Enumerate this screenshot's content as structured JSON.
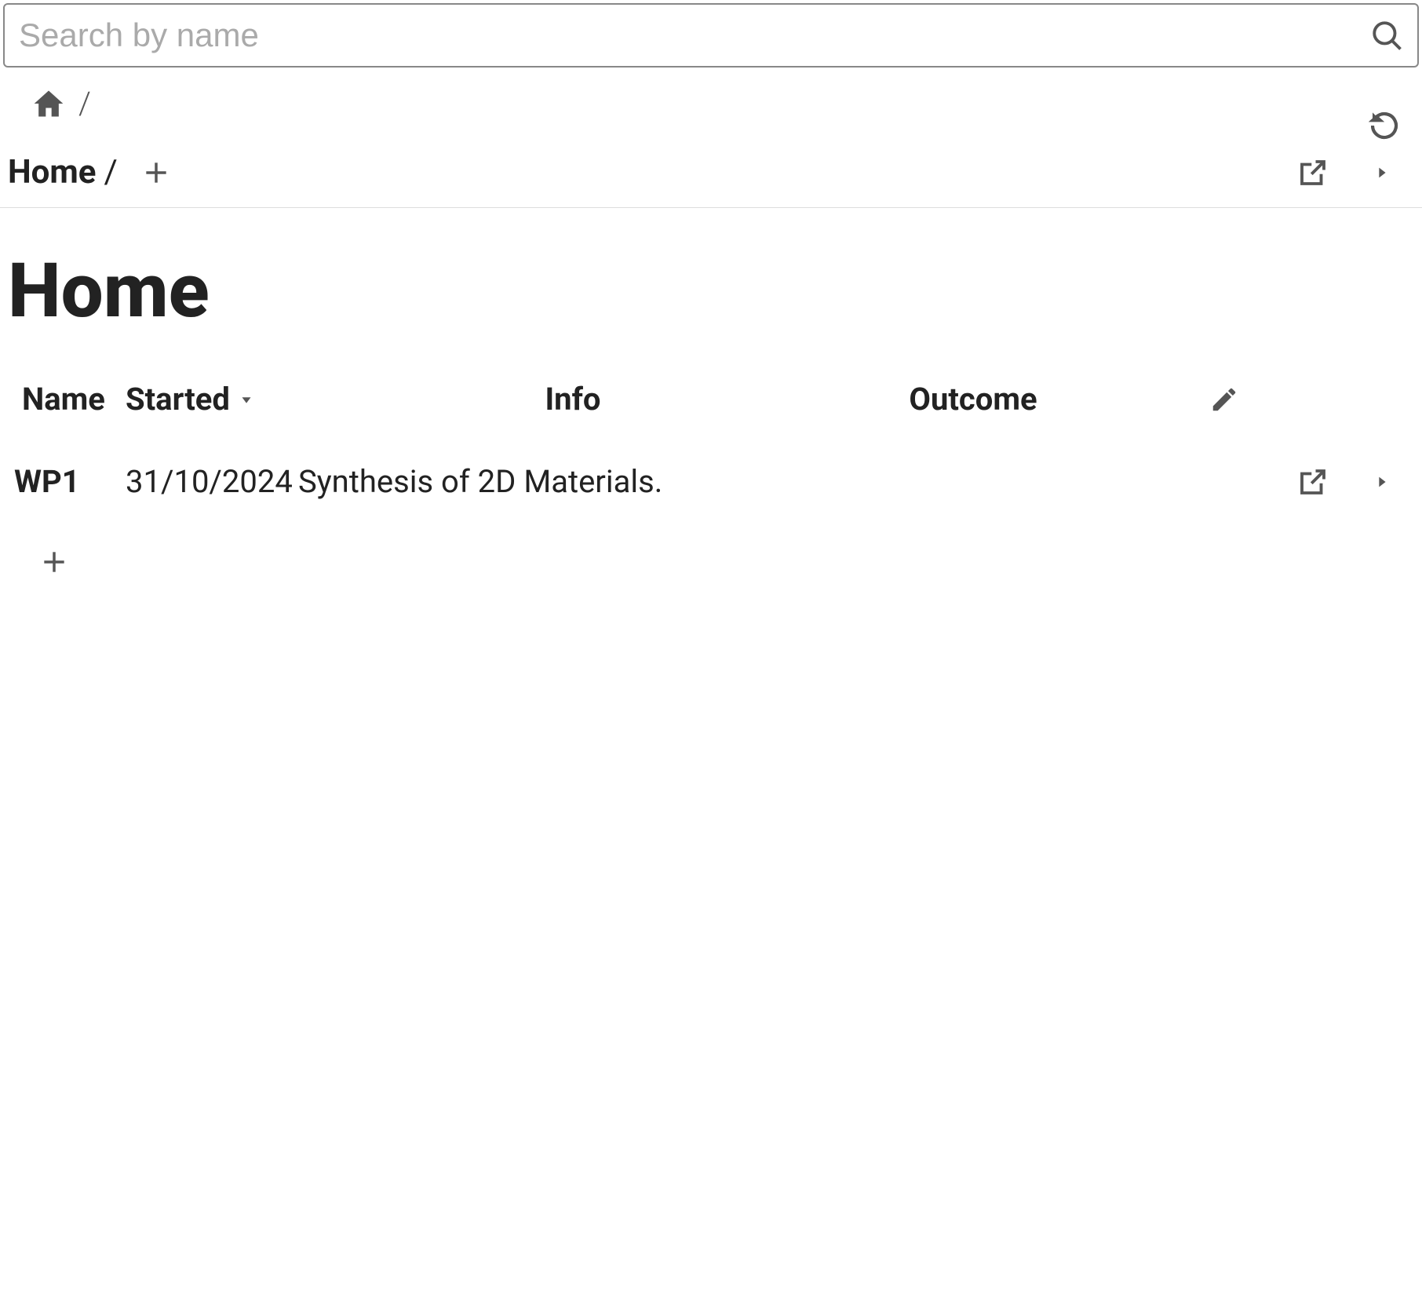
{
  "search": {
    "placeholder": "Search by name",
    "value": ""
  },
  "breadcrumb": {
    "separator": "/"
  },
  "path": {
    "label": "Home",
    "separator": "/"
  },
  "page": {
    "title": "Home"
  },
  "table": {
    "columns": {
      "name": "Name",
      "started": "Started",
      "info": "Info",
      "outcome": "Outcome"
    },
    "rows": [
      {
        "name": "WP1",
        "started": "31/10/2024",
        "info": "Synthesis of 2D Materials.",
        "outcome": ""
      }
    ]
  }
}
